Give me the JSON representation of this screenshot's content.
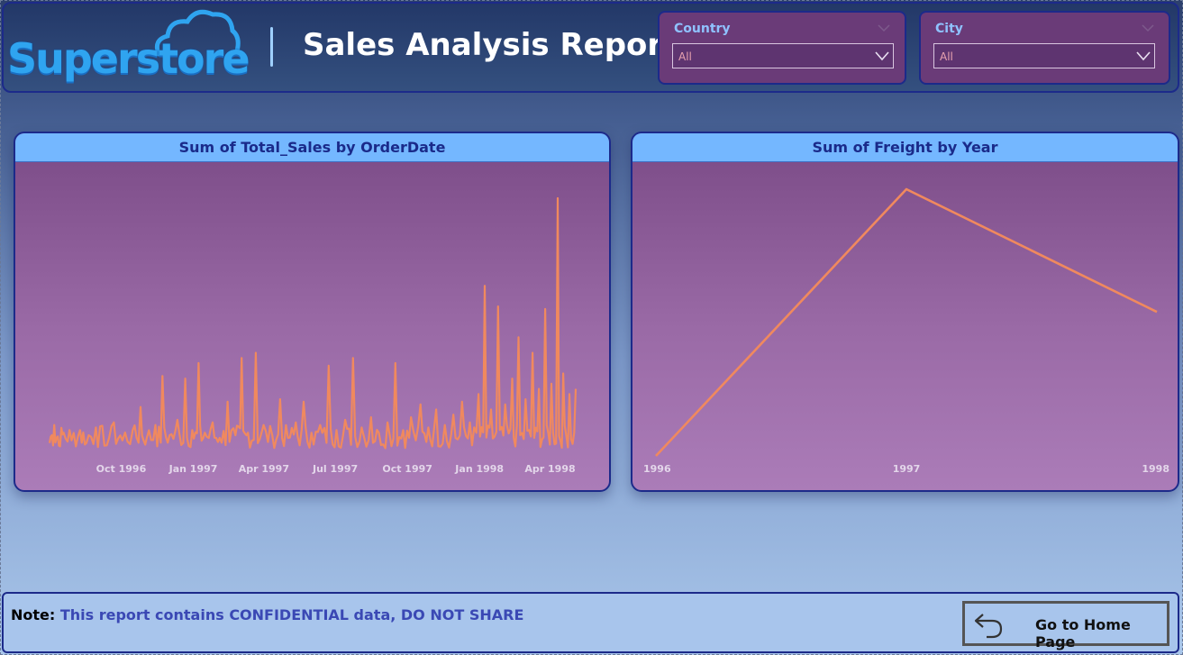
{
  "header": {
    "logo_text": "Superstore",
    "title": "Sales Analysis Report"
  },
  "slicers": {
    "country": {
      "label": "Country",
      "value": "All"
    },
    "city": {
      "label": "City",
      "value": "All"
    }
  },
  "colors": {
    "line": "#f0895e",
    "card_header": "#74b7ff",
    "card_title_text": "#1a2a8a",
    "border": "#1c2a8a"
  },
  "chart_data": [
    {
      "type": "line",
      "title": "Sum of Total_Sales by OrderDate",
      "xlabel": "",
      "ylabel": "",
      "x_ticks": [
        "Oct 1996",
        "Jan 1997",
        "Apr 1997",
        "Jul 1997",
        "Oct 1997",
        "Jan 1998",
        "Apr 1998"
      ],
      "x_range": [
        "1996-07-04",
        "1998-05-06"
      ],
      "grid": false,
      "series": [
        {
          "values_note_free": true,
          "points": [
            [
              "1996-07-04",
              0.05
            ],
            [
              "1996-07-10",
              0.12
            ],
            [
              "1996-07-16",
              0.04
            ],
            [
              "1996-07-22",
              0.09
            ],
            [
              "1996-08-01",
              0.06
            ],
            [
              "1996-08-12",
              0.1
            ],
            [
              "1996-08-20",
              0.05
            ],
            [
              "1996-09-01",
              0.11
            ],
            [
              "1996-09-12",
              0.04
            ],
            [
              "1996-09-24",
              0.13
            ],
            [
              "1996-10-05",
              0.06
            ],
            [
              "1996-10-18",
              0.1
            ],
            [
              "1996-10-28",
              0.19
            ],
            [
              "1996-11-05",
              0.07
            ],
            [
              "1996-11-16",
              0.12
            ],
            [
              "1996-11-25",
              0.31
            ],
            [
              "1996-12-04",
              0.08
            ],
            [
              "1996-12-14",
              0.14
            ],
            [
              "1996-12-24",
              0.3
            ],
            [
              "1997-01-02",
              0.1
            ],
            [
              "1997-01-10",
              0.36
            ],
            [
              "1997-01-18",
              0.09
            ],
            [
              "1997-01-28",
              0.13
            ],
            [
              "1997-02-06",
              0.07
            ],
            [
              "1997-02-16",
              0.21
            ],
            [
              "1997-02-26",
              0.08
            ],
            [
              "1997-03-06",
              0.38
            ],
            [
              "1997-03-14",
              0.09
            ],
            [
              "1997-03-24",
              0.4
            ],
            [
              "1997-04-03",
              0.12
            ],
            [
              "1997-04-14",
              0.08
            ],
            [
              "1997-04-24",
              0.22
            ],
            [
              "1997-05-04",
              0.07
            ],
            [
              "1997-05-14",
              0.13
            ],
            [
              "1997-05-24",
              0.21
            ],
            [
              "1997-06-03",
              0.09
            ],
            [
              "1997-06-14",
              0.12
            ],
            [
              "1997-06-25",
              0.35
            ],
            [
              "1997-07-05",
              0.1
            ],
            [
              "1997-07-16",
              0.14
            ],
            [
              "1997-07-26",
              0.38
            ],
            [
              "1997-08-06",
              0.11
            ],
            [
              "1997-08-18",
              0.15
            ],
            [
              "1997-08-28",
              0.09
            ],
            [
              "1997-09-08",
              0.13
            ],
            [
              "1997-09-18",
              0.36
            ],
            [
              "1997-09-28",
              0.1
            ],
            [
              "1997-10-08",
              0.15
            ],
            [
              "1997-10-20",
              0.2
            ],
            [
              "1997-10-30",
              0.11
            ],
            [
              "1997-11-09",
              0.18
            ],
            [
              "1997-11-20",
              0.12
            ],
            [
              "1997-12-01",
              0.16
            ],
            [
              "1997-12-12",
              0.21
            ],
            [
              "1997-12-22",
              0.13
            ],
            [
              "1998-01-02",
              0.24
            ],
            [
              "1998-01-10",
              0.66
            ],
            [
              "1998-01-18",
              0.18
            ],
            [
              "1998-01-27",
              0.58
            ],
            [
              "1998-02-05",
              0.2
            ],
            [
              "1998-02-14",
              0.3
            ],
            [
              "1998-02-22",
              0.46
            ],
            [
              "1998-03-03",
              0.22
            ],
            [
              "1998-03-12",
              0.4
            ],
            [
              "1998-03-20",
              0.26
            ],
            [
              "1998-03-28",
              0.57
            ],
            [
              "1998-04-05",
              0.28
            ],
            [
              "1998-04-13",
              1.0
            ],
            [
              "1998-04-20",
              0.32
            ],
            [
              "1998-04-28",
              0.24
            ],
            [
              "1998-05-06",
              0.26
            ]
          ]
        }
      ]
    },
    {
      "type": "line",
      "title": "Sum of Freight by Year",
      "xlabel": "",
      "ylabel": "",
      "categories": [
        "1996",
        "1997",
        "1998"
      ],
      "grid": false,
      "series": [
        {
          "values": [
            0.0,
            1.0,
            0.54
          ]
        }
      ]
    }
  ],
  "footer": {
    "note_label": "Note:",
    "note_text": " This report contains CONFIDENTIAL data, DO NOT SHARE",
    "home_button": "Go to Home Page"
  }
}
